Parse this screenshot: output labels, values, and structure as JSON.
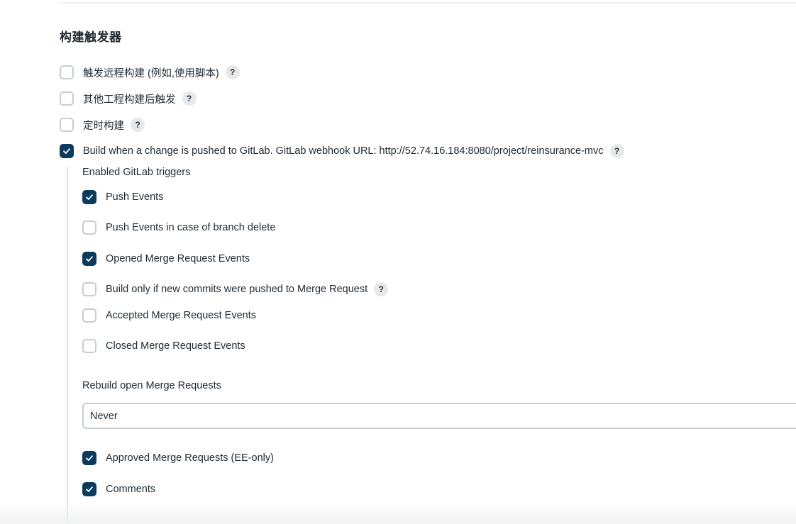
{
  "section": {
    "title": "构建触发器"
  },
  "triggers": [
    {
      "label": "触发远程构建 (例如,使用脚本)",
      "checked": false,
      "has_help": true
    },
    {
      "label": "其他工程构建后触发",
      "checked": false,
      "has_help": true
    },
    {
      "label": "定时构建",
      "checked": false,
      "has_help": true
    },
    {
      "label": "Build when a change is pushed to GitLab. GitLab webhook URL: http://52.74.16.184:8080/project/reinsurance-mvc",
      "checked": true,
      "has_help": true
    }
  ],
  "gitlab": {
    "enabled_triggers_label": "Enabled GitLab triggers",
    "options": [
      {
        "label": "Push Events",
        "checked": true,
        "has_help": false
      },
      {
        "label": "Push Events in case of branch delete",
        "checked": false,
        "has_help": false
      },
      {
        "label": "Opened Merge Request Events",
        "checked": true,
        "has_help": false
      },
      {
        "label": "Build only if new commits were pushed to Merge Request",
        "checked": false,
        "has_help": true
      },
      {
        "label": "Accepted Merge Request Events",
        "checked": false,
        "has_help": false
      },
      {
        "label": "Closed Merge Request Events",
        "checked": false,
        "has_help": false
      }
    ],
    "rebuild_label": "Rebuild open Merge Requests",
    "rebuild_selected": "Never",
    "extra_options": [
      {
        "label": "Approved Merge Requests (EE-only)",
        "checked": true,
        "has_help": false
      },
      {
        "label": "Comments",
        "checked": true,
        "has_help": false
      }
    ]
  },
  "help_glyph": "?",
  "colors": {
    "checked_fill": "#0b3b5c",
    "unchecked_border": "#c7cdd2",
    "help_bg": "#e6e8ea"
  }
}
